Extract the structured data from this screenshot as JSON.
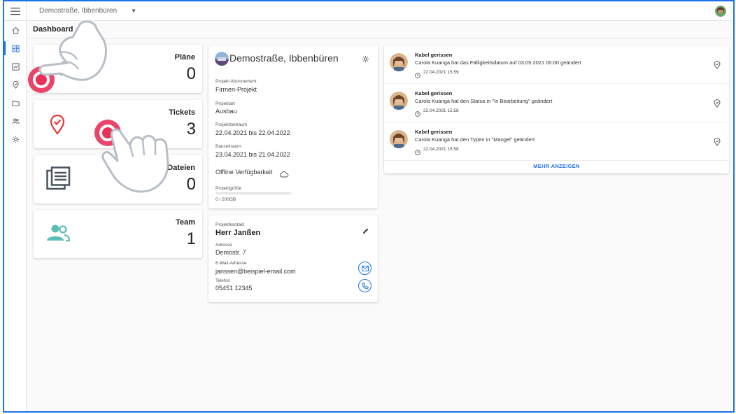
{
  "topbar": {
    "project_name": "Demostraße, Ibbenbüren"
  },
  "page": {
    "title": "Dashboard"
  },
  "sidebar": {
    "items": [
      {
        "name": "home-icon"
      },
      {
        "name": "dashboard-icon",
        "active": true
      },
      {
        "name": "chart-icon"
      },
      {
        "name": "location-pin-icon"
      },
      {
        "name": "folder-icon"
      },
      {
        "name": "team-icon"
      },
      {
        "name": "gear-icon"
      }
    ]
  },
  "stats": {
    "plans": {
      "label": "Pläne",
      "value": "0"
    },
    "tickets": {
      "label": "Tickets",
      "value": "3"
    },
    "files": {
      "label": "Dateien",
      "value": "0"
    },
    "team": {
      "label": "Team",
      "value": "1"
    }
  },
  "project": {
    "title": "Demostraße, Ibbenbüren",
    "subscription_label": "Projekt Abonnement",
    "subscription_value": "Firmen-Projekt",
    "type_label": "Projektart",
    "type_value": "Ausbau",
    "period_label": "Projektzeitraum",
    "period_value": "22.04.2021 bis 22.04.2022",
    "build_label": "Bauzeitraum",
    "build_value": "23.04.2021 bis 21.04.2022",
    "offline_label": "Offline Verfügbarkeit",
    "size_label": "Projektgröße",
    "size_value": "0 / 200GB",
    "size_fraction": 0
  },
  "contact": {
    "heading": "Projektkontakt",
    "name": "Herr Janßen",
    "address_label": "Adresse",
    "address_value": "Demostr. 7",
    "email_label": "E-Mail-Adresse",
    "email_value": "janssen@beispiel-email.com",
    "phone_label": "Telefon",
    "phone_value": "05451 12345"
  },
  "activity": {
    "items": [
      {
        "title": "Kabel gerissen",
        "text": "Carola Kuanga hat das Fälligkeitsdatum auf 03.05.2021 00:00 geändert",
        "date": "22.04.2021 15:59"
      },
      {
        "title": "Kabel gerissen",
        "text": "Carola Kuanga hat den Status in \"In Bearbeitung\" geändert",
        "date": "22.04.2021 15:58"
      },
      {
        "title": "Kabel gerissen",
        "text": "Carola Kuanga hat den Typen in \"Mangel\" geändert",
        "date": "22.04.2021 15:58"
      }
    ],
    "more_label": "MEHR ANZEIGEN"
  },
  "colors": {
    "accent": "#1e72e8",
    "ticket_red": "#e53935",
    "team_teal": "#5bbfb5",
    "files_dark": "#4a5560"
  }
}
